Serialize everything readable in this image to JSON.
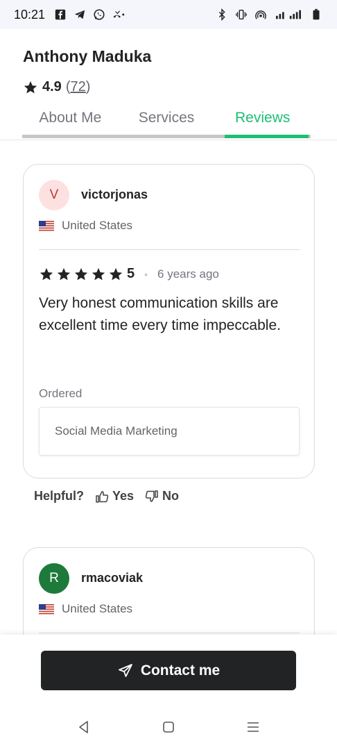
{
  "status_bar": {
    "time": "10:21",
    "left_icons": [
      "facebook-icon",
      "telegram-icon",
      "whatsapp-icon",
      "missed-call-icon"
    ],
    "right_icons": [
      "bluetooth-icon",
      "vibrate-icon",
      "hotspot-icon",
      "signal-icon",
      "battery-icon"
    ]
  },
  "header": {
    "seller_name": "Anthony Maduka",
    "rating": "4.9",
    "rating_count": "72",
    "tabs": [
      {
        "label": "About Me",
        "active": false
      },
      {
        "label": "Services",
        "active": false
      },
      {
        "label": "Reviews",
        "active": true
      }
    ]
  },
  "reviews": [
    {
      "avatar_letter": "V",
      "username": "victorjonas",
      "country": "United States",
      "score": "5",
      "time_ago": "6 years ago",
      "text": "Very honest communication skills are excellent time every time impeccable.",
      "ordered_label": "Ordered",
      "ordered_service": "Social Media Marketing",
      "star_count": 5
    },
    {
      "avatar_letter": "R",
      "username": "rmacoviak",
      "country": "United States"
    }
  ],
  "helpful": {
    "label": "Helpful?",
    "yes": "Yes",
    "no": "No"
  },
  "contact": {
    "label": "Contact me"
  },
  "colors": {
    "accent": "#1dbf73",
    "button_bg": "#222325",
    "star": "#222325"
  }
}
